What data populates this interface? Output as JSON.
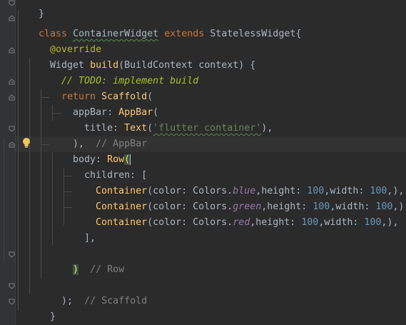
{
  "lines": {
    "l0": "}",
    "l1": {
      "kw1": "class",
      "name": "ContainerWidget",
      "kw2": "extends",
      "parent": "StatelessWidget",
      "brace": "{"
    },
    "l2": {
      "ann": "@override"
    },
    "l3": {
      "type": "Widget",
      "fn": "build",
      "args": "(BuildContext context) {"
    },
    "l4": {
      "comment": "// TODO: implement build"
    },
    "l5": {
      "kw": "return",
      "fn": "Scaffold",
      "paren": "("
    },
    "l6": {
      "prop": "appBar: ",
      "fn": "AppBar",
      "paren": "("
    },
    "l7": {
      "prop": "title: ",
      "fn": "Text",
      "open": "(",
      "str": "'flutter container'",
      "close": "),"
    },
    "l8": {
      "code": "),",
      "comment": "// AppBar"
    },
    "l9": {
      "prop": "body: ",
      "fn": "Row",
      "paren": "("
    },
    "l10": {
      "code": "children: ["
    },
    "l11": {
      "fn": "Container",
      "a": "(color: Colors.",
      "color": "blue",
      "b": ",height: ",
      "h": "100",
      "c": ",width: ",
      "w": "100",
      "d": ",),"
    },
    "l12": {
      "fn": "Container",
      "a": "(color: Colors.",
      "color": "green",
      "b": ",height: ",
      "h": "100",
      "c": ",width: ",
      "w": "100",
      "d": ",),"
    },
    "l13": {
      "fn": "Container",
      "a": "(color: Colors.",
      "color": "red",
      "b": ",height: ",
      "h": "100",
      "c": ",width: ",
      "w": "100",
      "d": ",),"
    },
    "l14": {
      "code": "],"
    },
    "l16": {
      "paren": ")",
      "comment": "// Row"
    },
    "l18": {
      "code": ");",
      "comment": "// Scaffold"
    },
    "l19": {
      "code": "}"
    }
  }
}
